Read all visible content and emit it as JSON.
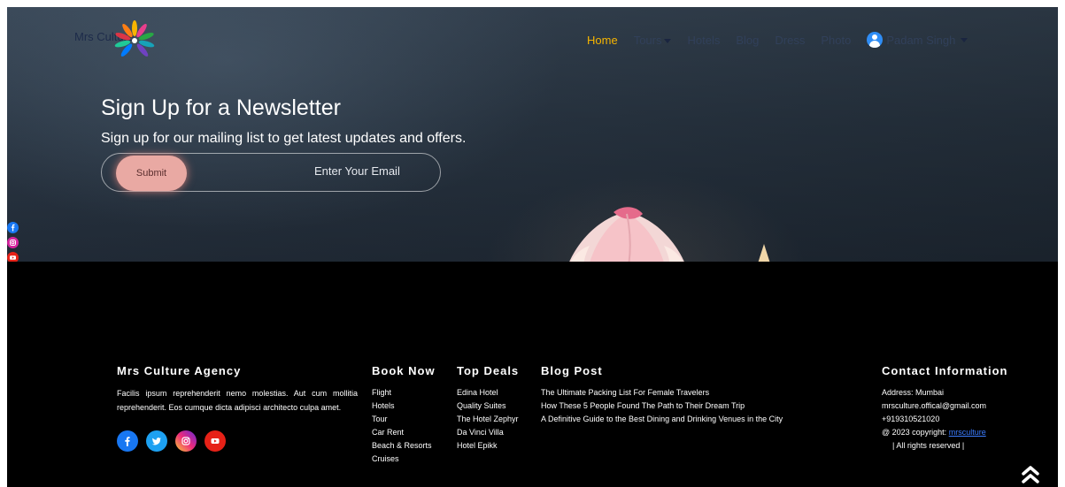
{
  "brand": {
    "logo_text": "Mrs Culture"
  },
  "nav": {
    "items": [
      {
        "label": "Home",
        "active": true
      },
      {
        "label": "Tours",
        "dropdown": true
      },
      {
        "label": "Hotels"
      },
      {
        "label": "Blog"
      },
      {
        "label": "Dress"
      },
      {
        "label": "Photo"
      }
    ],
    "user": {
      "name": "Padam Singh"
    }
  },
  "newsletter": {
    "title": "Sign Up for a Newsletter",
    "subtitle": "Sign up for our mailing list to get latest updates and offers.",
    "submit_label": "Submit",
    "email_placeholder": "Enter Your Email"
  },
  "footer": {
    "about": {
      "title": "Mrs Culture Agency",
      "text": "Facilis ipsum reprehenderit nemo molestias. Aut cum mollitia reprehenderit. Eos cumque dicta adipisci architecto culpa amet."
    },
    "book_now": {
      "title": "Book Now",
      "items": [
        "Flight",
        "Hotels",
        "Tour",
        "Car Rent",
        "Beach & Resorts",
        "Cruises"
      ]
    },
    "top_deals": {
      "title": "Top Deals",
      "items": [
        "Edina Hotel",
        "Quality Suites",
        "The Hotel Zephyr",
        "Da Vinci Villa",
        "Hotel Epikk"
      ]
    },
    "blog_post": {
      "title": "Blog Post",
      "items": [
        "The Ultimate Packing List For Female Travelers",
        "How These 5 People Found The Path to Their Dream Trip",
        "A Definitive Guide to the Best Dining and Drinking Venues in the City"
      ]
    },
    "contact": {
      "title": "Contact Information",
      "address": "Address: Mumbai",
      "email": "mrsculture.offical@gmail.com",
      "phone": "+919310521020",
      "copyright_prefix": "@ 2023 copyright:",
      "copyright_link": "mrsculture",
      "rights": "| All rights reserved |"
    }
  },
  "colors": {
    "accent": "#f7b500",
    "facebook": "#1877f2",
    "twitter": "#1da1f2",
    "instagram": "#c13584",
    "youtube": "#e62117"
  },
  "icons": {
    "side": [
      "facebook-icon",
      "instagram-icon",
      "youtube-icon"
    ],
    "footer": [
      "facebook-icon",
      "twitter-icon",
      "instagram-icon",
      "youtube-icon"
    ],
    "scroll": "double-chevron-up-icon"
  }
}
